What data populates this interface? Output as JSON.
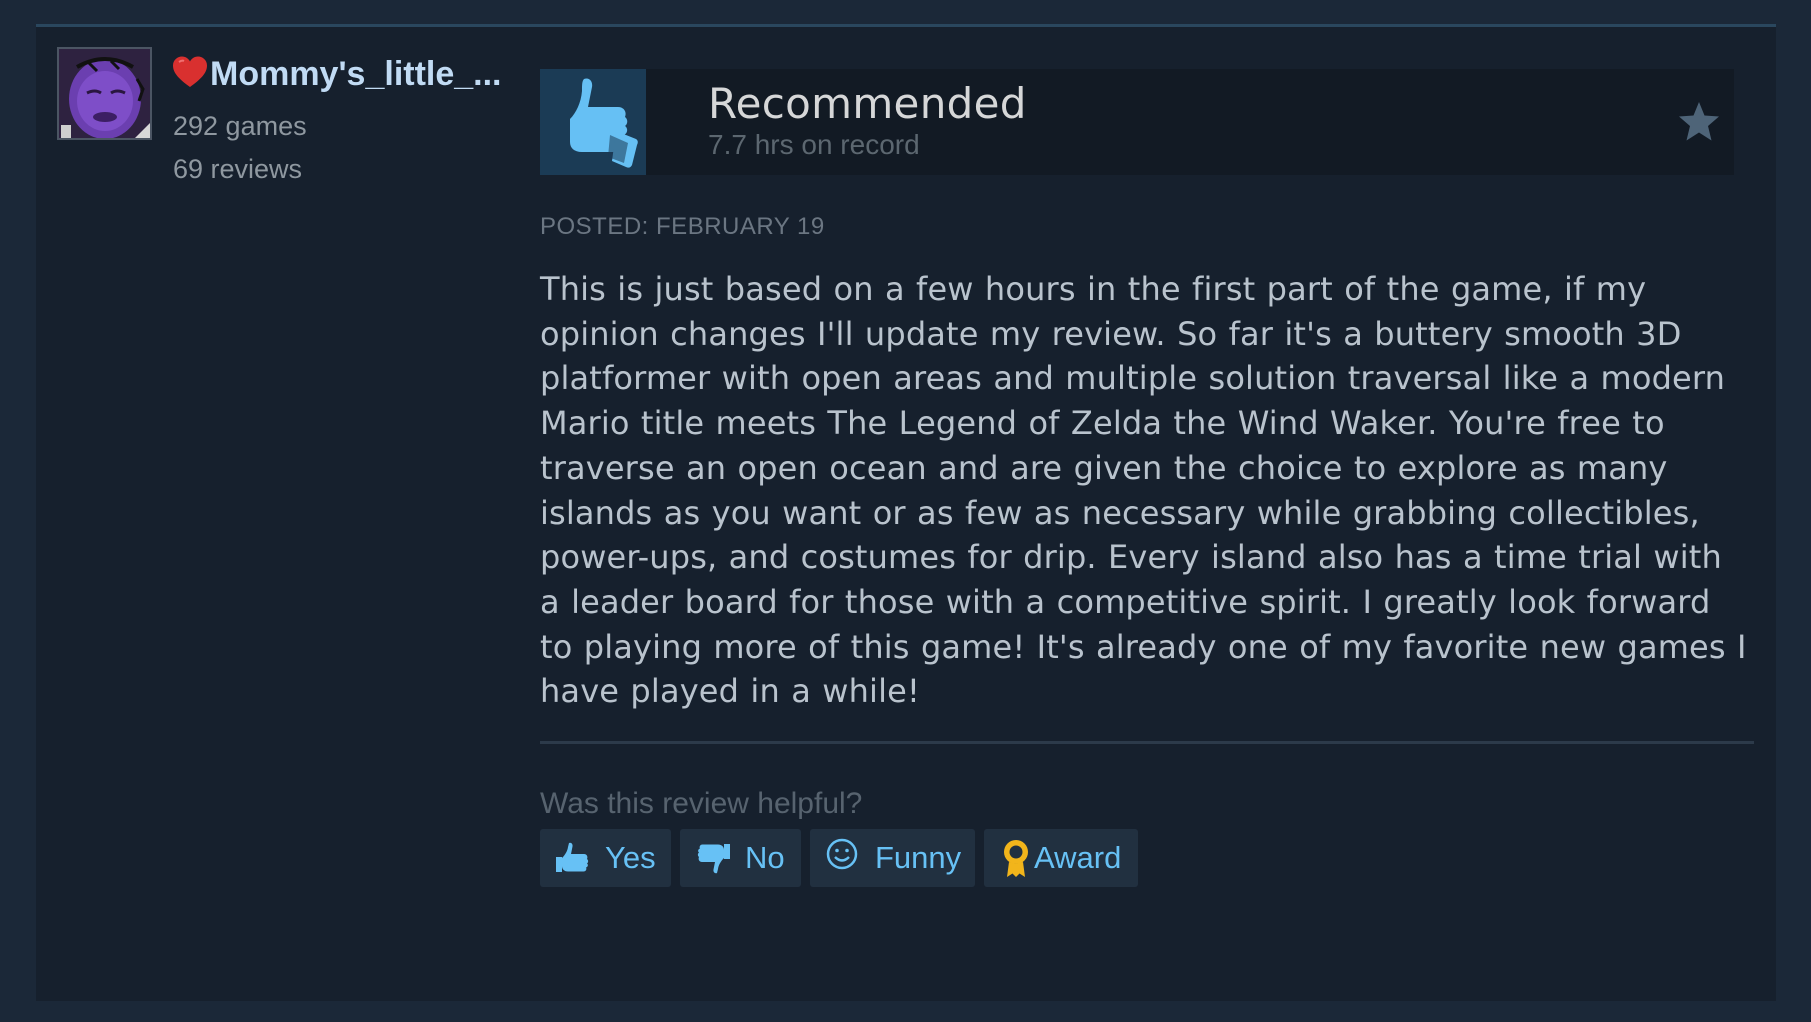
{
  "user": {
    "name": "Mommy's_little_...",
    "games": "292 games",
    "reviews": "69 reviews"
  },
  "review": {
    "verdict": "Recommended",
    "hours": "7.7 hrs on record",
    "posted": "POSTED: FEBRUARY 19",
    "body": "This is just based on a few hours in the first part of the game, if my opinion changes I'll update my review. So far it's a buttery smooth 3D platformer with open areas and multiple solution traversal like a modern Mario title meets The Legend of Zelda the Wind Waker. You're free to traverse an open ocean and are given the choice to explore as many islands as you want or as few as necessary while grabbing collectibles, power-ups, and costumes for drip. Every island also has a time trial with a leader board for those with a competitive spirit. I greatly look forward to playing more of this game! It's already one of my favorite new games I have played in a while!"
  },
  "helpful": {
    "question": "Was this review helpful?",
    "buttons": {
      "yes": "Yes",
      "no": "No",
      "funny": "Funny",
      "award": "Award"
    }
  },
  "icons": {
    "heart": "heart-icon",
    "thumbs_up": "thumbs-up-icon",
    "thumbs_down": "thumbs-down-icon",
    "smiley": "smiley-icon",
    "award": "award-icon",
    "star": "star-icon"
  },
  "colors": {
    "background": "#1b2838",
    "card": "#16202d",
    "accent": "#67c1f5",
    "username": "#c1dbf4",
    "heart": "#d9302f",
    "award": "#f2b51b"
  }
}
